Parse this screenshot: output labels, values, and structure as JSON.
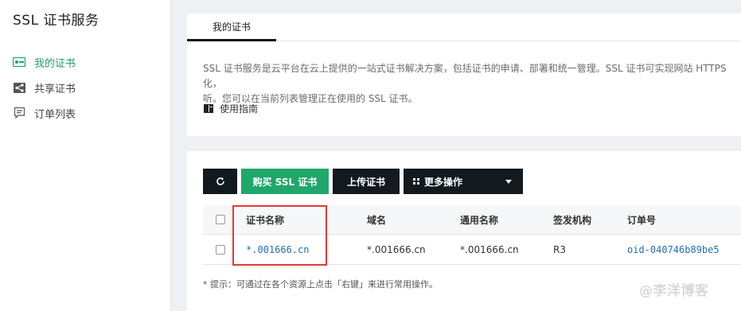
{
  "sidebar": {
    "title": "SSL 证书服务",
    "items": [
      {
        "label": "我的证书",
        "icon": "certificate-icon",
        "active": true
      },
      {
        "label": "共享证书",
        "icon": "share-icon",
        "active": false
      },
      {
        "label": "订单列表",
        "icon": "order-icon",
        "active": false
      }
    ]
  },
  "tabs": [
    {
      "label": "我的证书",
      "active": true
    }
  ],
  "description": "SSL 证书服务是云平台在云上提供的一站式证书解决方案，包括证书的申请、部署和统一管理。SSL 证书可实现网站 HTTPS 化，\n听。您可以在当前列表管理正在使用的 SSL 证书。",
  "guide_link": "使用指南",
  "toolbar": {
    "refresh_icon": "refresh-icon",
    "buy_label": "购买 SSL 证书",
    "upload_label": "上传证书",
    "more_label": "更多操作"
  },
  "table": {
    "headers": [
      "证书名称",
      "域名",
      "通用名称",
      "签发机构",
      "订单号"
    ],
    "rows": [
      {
        "name": "*.001666.cn",
        "domain": "*.001666.cn",
        "common_name": "*.001666.cn",
        "issuer": "R3",
        "order_id": "oid-040746b89be5"
      }
    ]
  },
  "hint": "* 提示：可通过在各个资源上点击「右键」来进行常用操作。",
  "watermark": "@李洋博客",
  "colors": {
    "accent": "#1aa36a",
    "buy_button": "#20a76b",
    "dark_button": "#12191f",
    "link": "#1f6fb5",
    "highlight": "#e53935"
  }
}
